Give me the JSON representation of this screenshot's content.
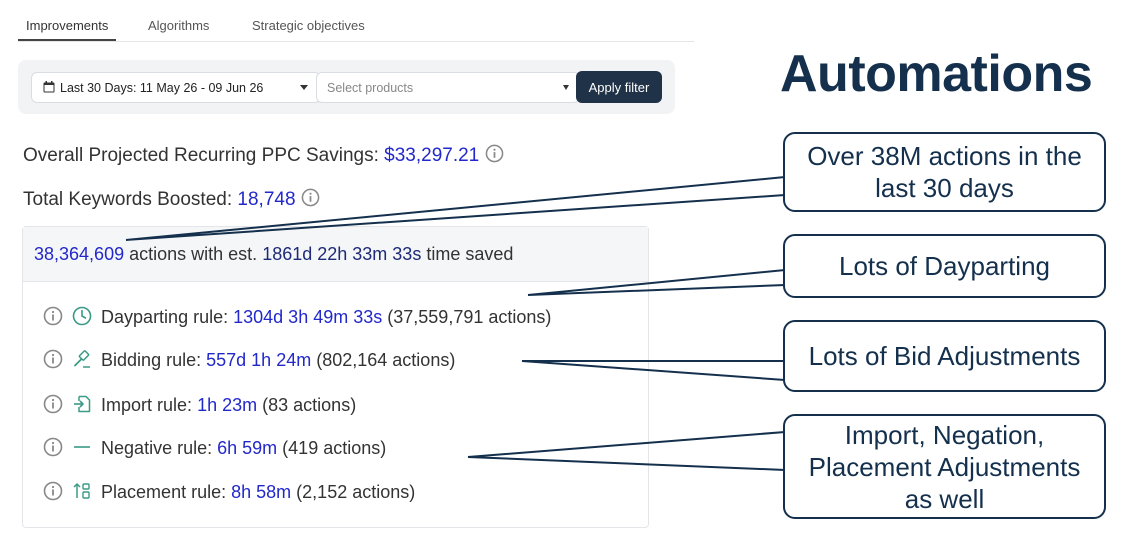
{
  "tabs": [
    {
      "label": "Improvements",
      "active": true
    },
    {
      "label": "Algorithms",
      "active": false
    },
    {
      "label": "Strategic objectives",
      "active": false
    }
  ],
  "filter": {
    "date_range": "Last 30 Days: 11 May 26 - 09 Jun 26",
    "products_placeholder": "Select products",
    "apply_label": "Apply filter"
  },
  "stats": {
    "savings_label": "Overall Projected Recurring PPC Savings:",
    "savings_value": "$33,297.21",
    "keywords_label": "Total Keywords Boosted:",
    "keywords_value": "18,748"
  },
  "actions": {
    "total_count": "38,364,609",
    "mid_text": "actions with est.",
    "time_saved": "1861d 22h 33m 33s",
    "tail_text": "time saved"
  },
  "rules": [
    {
      "label": "Dayparting rule:",
      "time": "1304d 3h 49m 33s",
      "count": "(37,559,791 actions)",
      "icon": "clock-icon"
    },
    {
      "label": "Bidding rule:",
      "time": "557d 1h 24m",
      "count": "(802,164 actions)",
      "icon": "gavel-icon"
    },
    {
      "label": "Import rule:",
      "time": "1h 23m",
      "count": "(83 actions)",
      "icon": "import-icon"
    },
    {
      "label": "Negative rule:",
      "time": "6h 59m",
      "count": "(419 actions)",
      "icon": "minus-icon"
    },
    {
      "label": "Placement rule:",
      "time": "8h 58m",
      "count": "(2,152 actions)",
      "icon": "placement-icon"
    }
  ],
  "headline": "Automations",
  "callouts": [
    "Over 38M actions in the last 30 days",
    "Lots of Dayparting",
    "Lots of Bid Adjustments",
    "Import, Negation, Placement Adjustments as well"
  ],
  "colors": {
    "accent_blue": "#2228c9",
    "navy": "#14304d",
    "icon_teal": "#3b9a86",
    "button_dark": "#1f3247"
  }
}
